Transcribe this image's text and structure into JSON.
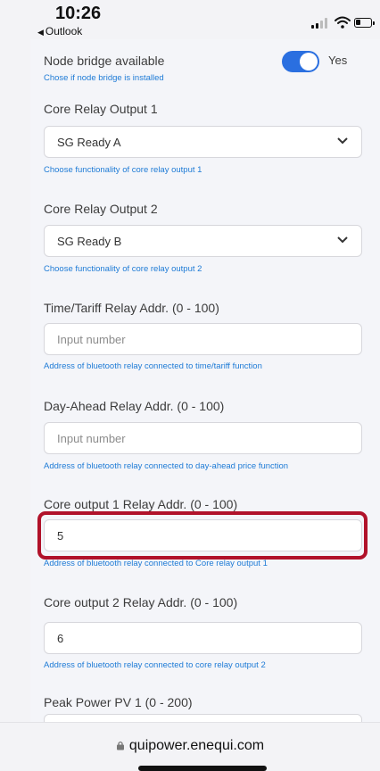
{
  "status_bar": {
    "time": "10:26",
    "back_app": "Outlook"
  },
  "node_bridge": {
    "label": "Node bridge available",
    "helper": "Chose if node bridge is installed",
    "toggle_state": "Yes"
  },
  "core_relay_1": {
    "label": "Core Relay Output 1",
    "value": "SG Ready A",
    "helper": "Choose functionality of core relay output 1"
  },
  "core_relay_2": {
    "label": "Core Relay Output 2",
    "value": "SG Ready B",
    "helper": "Choose functionality of core relay output 2"
  },
  "time_tariff": {
    "label": "Time/Tariff Relay Addr. (0 - 100)",
    "placeholder": "Input number",
    "helper": "Address of bluetooth relay connected to time/tariff function"
  },
  "day_ahead": {
    "label": "Day-Ahead Relay Addr. (0 - 100)",
    "placeholder": "Input number",
    "helper": "Address of bluetooth relay connected to day-ahead price function"
  },
  "core_out_1_addr": {
    "label": "Core output 1 Relay Addr. (0 - 100)",
    "value": "5",
    "helper": "Address of bluetooth relay connected to Core relay output 1"
  },
  "core_out_2_addr": {
    "label": "Core output 2 Relay Addr. (0 - 100)",
    "value": "6",
    "helper": "Address of bluetooth relay connected to core relay output 2"
  },
  "peak_power": {
    "label": "Peak Power PV 1 (0 - 200)"
  },
  "browser": {
    "url": "quipower.enequi.com"
  },
  "colors": {
    "accent": "#2a6fe0",
    "helper_text": "#1e7bd6",
    "highlight": "#b1122a"
  }
}
